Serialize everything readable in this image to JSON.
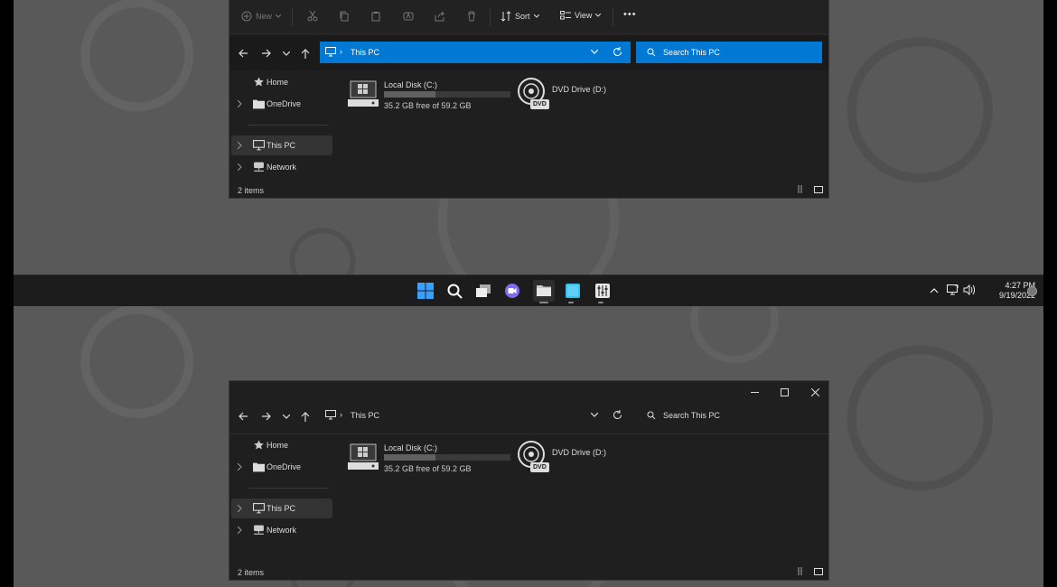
{
  "colors": {
    "accent": "#0078d4",
    "window_bg": "#1f1f1f",
    "taskbar_bg": "#1c1c1c",
    "desktop_bg": "#595959"
  },
  "commandbar": {
    "new_label": "New",
    "sort_label": "Sort",
    "view_label": "View",
    "more_label": "•••"
  },
  "address": {
    "location": "This PC",
    "chevron": "›"
  },
  "search": {
    "placeholder": "Search This PC"
  },
  "sidebar": {
    "items": [
      {
        "label": "Home",
        "icon": "star-icon"
      },
      {
        "label": "OneDrive",
        "icon": "folder-icon"
      },
      {
        "label": "This PC",
        "icon": "pc-icon",
        "selected": true
      },
      {
        "label": "Network",
        "icon": "network-icon"
      }
    ]
  },
  "drives": [
    {
      "name": "Local Disk (C:)",
      "free": "35.2 GB free of 59.2 GB",
      "used_fraction": 0.405,
      "icon": "hard-disk-icon"
    },
    {
      "name": "DVD Drive (D:)",
      "icon": "dvd-drive-icon",
      "badge": "DVD"
    }
  ],
  "status": {
    "item_count": "2 items"
  },
  "taskbar": {
    "apps": [
      "windows-start-icon",
      "search-icon",
      "task-view-icon",
      "chat-icon",
      "file-explorer-icon",
      "store-icon",
      "settings-sliders-icon"
    ]
  },
  "tray": {
    "time": "4:27 PM",
    "date": "9/19/2022"
  }
}
